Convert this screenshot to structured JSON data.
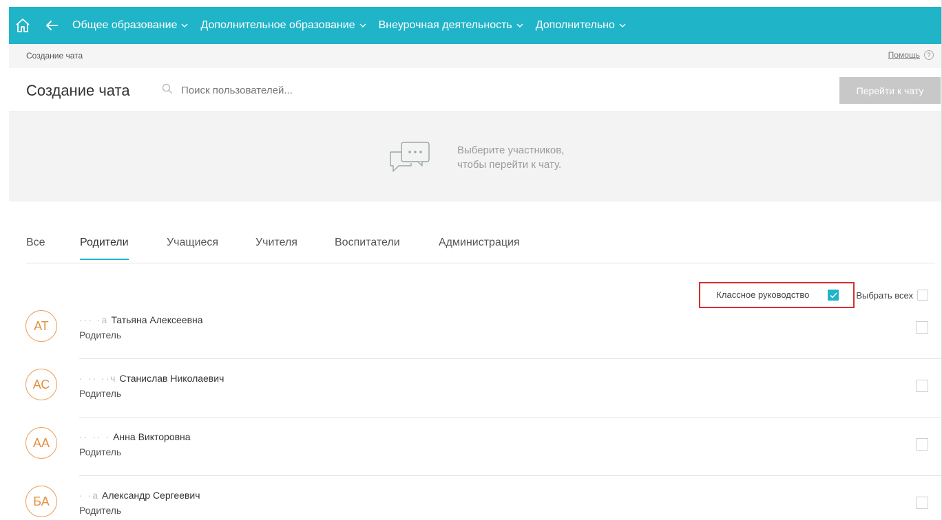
{
  "nav": {
    "menu": [
      {
        "label": "Общее образование"
      },
      {
        "label": "Дополнительное образование"
      },
      {
        "label": "Внеурочная деятельность"
      },
      {
        "label": "Дополнительно"
      }
    ],
    "bg_color": "#1fb4c8"
  },
  "breadcrumb": {
    "current": "Создание чата"
  },
  "help": {
    "label": "Помощь",
    "icon": "?"
  },
  "header": {
    "title": "Создание чата",
    "search_placeholder": "Поиск пользователей...",
    "goto_button": "Перейти к чату"
  },
  "hint": {
    "line1": "Выберите участников,",
    "line2": "чтобы перейти к чату."
  },
  "tabs": [
    {
      "label": "Все",
      "active": false
    },
    {
      "label": "Родители",
      "active": true
    },
    {
      "label": "Учащиеся",
      "active": false
    },
    {
      "label": "Учителя",
      "active": false
    },
    {
      "label": "Воспитатели",
      "active": false
    },
    {
      "label": "Администрация",
      "active": false
    }
  ],
  "options": {
    "class_guidance_label": "Классное руководство",
    "class_guidance_checked": true,
    "select_all_label": "Выбрать всех",
    "select_all_checked": false
  },
  "users": [
    {
      "initials": "АТ",
      "name_hidden": "··· ·а",
      "name": "Татьяна Алексеевна",
      "role": "Родитель",
      "selected": false
    },
    {
      "initials": "АС",
      "name_hidden": "· ·· ··ч",
      "name": "Станислав Николаевич",
      "role": "Родитель",
      "selected": false
    },
    {
      "initials": "АА",
      "name_hidden": "·· ·· ·",
      "name": "Анна Викторовна",
      "role": "Родитель",
      "selected": false
    },
    {
      "initials": "БА",
      "name_hidden": "· ·а",
      "name": "Александр Сергеевич",
      "role": "Родитель",
      "selected": false
    }
  ],
  "colors": {
    "accent": "#1fb4c8",
    "avatar": "#e38f3c",
    "highlight_border": "#d32f2f"
  }
}
